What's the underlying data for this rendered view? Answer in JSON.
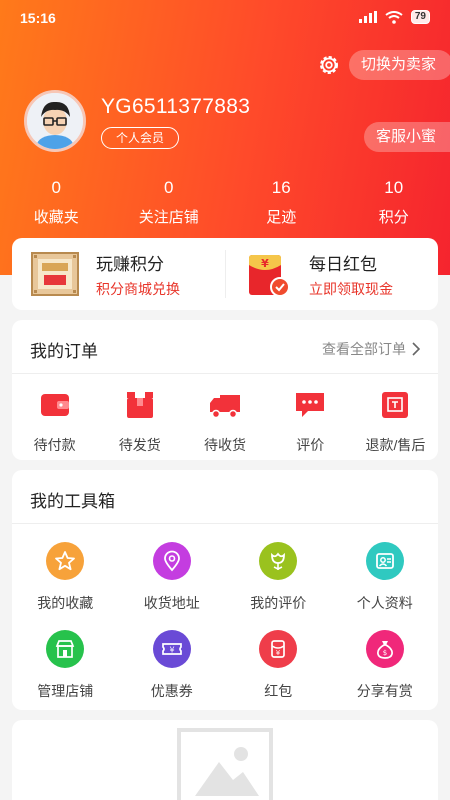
{
  "status_bar": {
    "time": "15:16",
    "battery": "79"
  },
  "header": {
    "switch_seller": "切换为卖家",
    "username": "YG6511377883",
    "member_badge": "个人会员",
    "customer_service": "客服小蜜",
    "settings_icon": "gear-icon"
  },
  "stats": [
    {
      "value": "0",
      "label": "收藏夹"
    },
    {
      "value": "0",
      "label": "关注店铺"
    },
    {
      "value": "16",
      "label": "足迹"
    },
    {
      "value": "10",
      "label": "积分"
    }
  ],
  "promo": [
    {
      "title": "玩赚积分",
      "subtitle": "积分商城兑换",
      "icon": "points-board-icon"
    },
    {
      "title": "每日红包",
      "subtitle": "立即领取现金",
      "icon": "red-envelope-icon"
    }
  ],
  "orders": {
    "title": "我的订单",
    "view_all": "查看全部订单",
    "items": [
      {
        "label": "待付款",
        "icon": "wallet-icon"
      },
      {
        "label": "待发货",
        "icon": "package-icon"
      },
      {
        "label": "待收货",
        "icon": "truck-icon"
      },
      {
        "label": "评价",
        "icon": "comment-icon"
      },
      {
        "label": "退款/售后",
        "icon": "refund-icon"
      }
    ]
  },
  "toolbox": {
    "title": "我的工具箱",
    "items": [
      {
        "label": "我的收藏",
        "icon": "star-icon",
        "color": "#f7a23a"
      },
      {
        "label": "收货地址",
        "icon": "location-icon",
        "color": "#c43de0"
      },
      {
        "label": "我的评价",
        "icon": "flower-icon",
        "color": "#9ac21e"
      },
      {
        "label": "个人资料",
        "icon": "profile-card-icon",
        "color": "#2fc9c0"
      },
      {
        "label": "管理店铺",
        "icon": "store-icon",
        "color": "#27c24c"
      },
      {
        "label": "优惠券",
        "icon": "coupon-icon",
        "color": "#6a4ad6"
      },
      {
        "label": "红包",
        "icon": "red-packet-icon",
        "color": "#ef3d4a"
      },
      {
        "label": "分享有赏",
        "icon": "money-bag-icon",
        "color": "#f0287a"
      }
    ]
  },
  "colors": {
    "accent": "#f5242e",
    "header_start": "#ff7a1a",
    "promo_text": "#e8352a"
  }
}
